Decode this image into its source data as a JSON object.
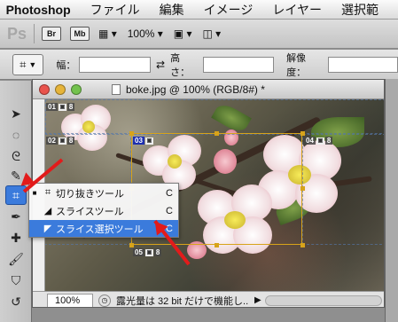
{
  "menubar": {
    "app_name": "Photoshop",
    "items": [
      "ファイル",
      "編集",
      "イメージ",
      "レイヤー",
      "選択範"
    ]
  },
  "appbar": {
    "ps_label": "Ps",
    "bridge_label": "Br",
    "minibridge_label": "Mb",
    "zoom_value": "100%"
  },
  "options": {
    "width_label": "幅：",
    "height_label": "高さ：",
    "resolution_label": "解像度："
  },
  "document": {
    "title": "boke.jpg @ 100% (RGB/8#) *",
    "slices": [
      {
        "number": "01"
      },
      {
        "number": "02"
      },
      {
        "number": "03"
      },
      {
        "number": "04"
      },
      {
        "number": "05"
      }
    ],
    "status": {
      "zoom": "100%",
      "message": "露光量は 32 bit だけで機能し..."
    }
  },
  "flyout": {
    "items": [
      {
        "label": "切り抜きツール",
        "shortcut": "C",
        "icon": "crop-icon"
      },
      {
        "label": "スライスツール",
        "shortcut": "C",
        "icon": "slice-knife-icon"
      },
      {
        "label": "スライス選択ツール",
        "shortcut": "C",
        "icon": "slice-select-icon"
      }
    ]
  },
  "colors": {
    "accent": "#3b7bdc",
    "annotation_arrow": "#e21b1b",
    "slice_selected": "#1d2fae",
    "selection_box": "#d7a31a"
  }
}
